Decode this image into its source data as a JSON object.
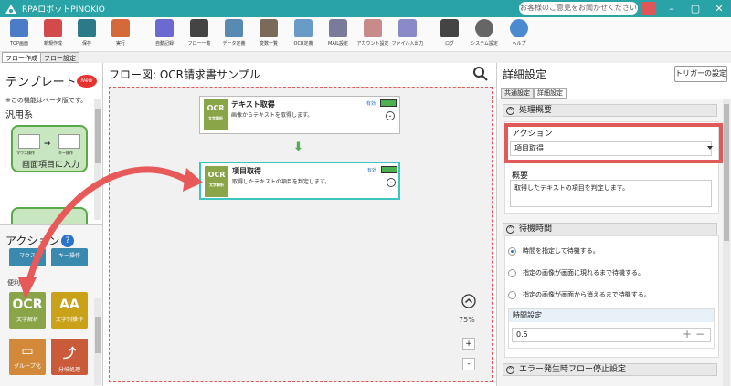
{
  "app": {
    "title": "RPAロボットPINOKIO",
    "feedback": "お客様のご意見をお聞かせください"
  },
  "toolbar": [
    {
      "label": "TOP画面",
      "color": "#4a7cc8"
    },
    {
      "label": "新規作成",
      "color": "#d24a4a"
    },
    {
      "label": "保存",
      "color": "#2a7a8a"
    },
    {
      "label": "実行",
      "color": "#d46a3a"
    },
    {
      "label": "自動記録",
      "color": "#6a6ad0"
    },
    {
      "label": "フロー一覧",
      "color": "#444444"
    },
    {
      "label": "データ定義",
      "color": "#5a8ab0"
    },
    {
      "label": "変数一覧",
      "color": "#7a6a5a"
    },
    {
      "label": "OCR定義",
      "color": "#6a9ac8"
    },
    {
      "label": "MAIL設定",
      "color": "#7a7a9a"
    },
    {
      "label": "アカウント設定",
      "color": "#c88a8a"
    },
    {
      "label": "ファイル入出力",
      "color": "#8a8ac8"
    },
    {
      "label": "ログ",
      "color": "#444444"
    },
    {
      "label": "システム設定",
      "color": "#666666"
    },
    {
      "label": "ヘルプ",
      "color": "#4a8ad0"
    }
  ],
  "main_tabs": [
    "フロー作成",
    "フロー設定"
  ],
  "left": {
    "template_title": "テンプレート",
    "new_badge": "New",
    "beta_note": "※この機能はベータ版です。",
    "category": "汎用系",
    "template_item": "画面項目に入力",
    "template_sub1": "マウス操作",
    "template_sub2": "キー操作",
    "actions_title": "アクション",
    "help_icon": "?",
    "action_row1": [
      "マウス",
      "キー操作"
    ],
    "section_label": "便利機能",
    "actions": [
      {
        "sym": "OCR",
        "label": "文字解析",
        "color": "#8aa548"
      },
      {
        "sym": "AA",
        "label": "文字列操作",
        "color": "#c9a21a"
      },
      {
        "sym": "▭",
        "label": "グループ化",
        "color": "#d28a3a"
      },
      {
        "sym": "⤴",
        "label": "分岐処理",
        "color": "#c95a3a"
      }
    ]
  },
  "center": {
    "title": "フロー図:  OCR請求書サンプル",
    "zoom": "75%",
    "nodes": [
      {
        "icon": "OCR",
        "icon_sub": "文字解析",
        "title": "テキスト取得",
        "desc": "画像からテキストを取得します。",
        "state": "有効"
      },
      {
        "icon": "OCR",
        "icon_sub": "文字解析",
        "title": "項目取得",
        "desc": "取得したテキストの項目を判定します。",
        "state": "有効"
      }
    ],
    "zoom_in": "+",
    "zoom_out": "-"
  },
  "right": {
    "title": "詳細設定",
    "trigger_button": "トリガーの設定",
    "tabs": [
      "共通設定",
      "詳細設定"
    ],
    "sec1": "処理概要",
    "action_label": "アクション",
    "action_value": "項目取得",
    "summary_label": "概要",
    "summary_value": "取得したテキストの項目を判定します。",
    "sec2": "待機時間",
    "radios": [
      "時間を指定して待機する。",
      "指定の画像が画面に現れるまで待機する。",
      "指定の画像が画面から消えるまで待機する。"
    ],
    "time_label": "時間設定",
    "time_value": "0.5",
    "sec3": "エラー発生時フロー停止設定"
  },
  "colors": {
    "accent": "#2aa3a6",
    "highlight_red": "#e05a5a",
    "selected_node": "#3cc4bf"
  }
}
